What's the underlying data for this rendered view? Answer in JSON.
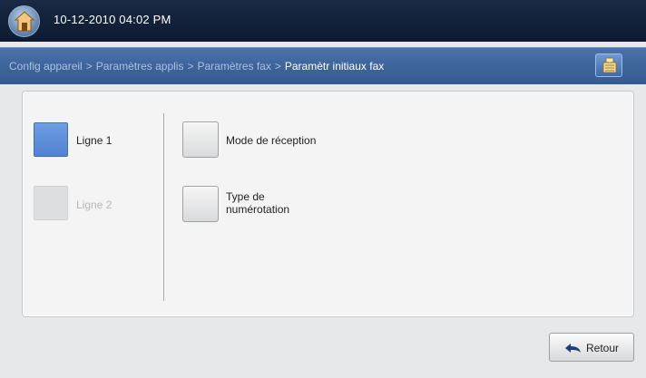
{
  "header": {
    "datetime": "10-12-2010 04:02 PM"
  },
  "breadcrumb": {
    "items": [
      "Config appareil",
      "Paramètres applis",
      "Paramètres fax"
    ],
    "separator": ">",
    "current": "Paramètr initiaux fax"
  },
  "lines": [
    {
      "label": "Ligne 1",
      "state": "selected"
    },
    {
      "label": "Ligne 2",
      "state": "disabled"
    }
  ],
  "options": [
    {
      "label": "Mode de réception"
    },
    {
      "label_line1": "Type de",
      "label_line2": "numérotation"
    }
  ],
  "footer": {
    "back_label": "Retour"
  },
  "icons": {
    "home": "home-icon",
    "job_status": "job-status-icon",
    "back": "undo-arrow-icon"
  },
  "colors": {
    "topbar": "#0c1a31",
    "navbar": "#3e659b",
    "selected": "#5a8cda"
  }
}
